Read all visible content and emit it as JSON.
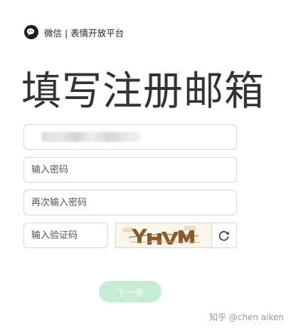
{
  "brand": {
    "text": "微信 | 表情开放平台",
    "logo_icon": "wechat-logo-icon"
  },
  "title": "填写注册邮箱",
  "form": {
    "email": {
      "value": "",
      "note": "value is blurred/obscured in screenshot"
    },
    "password": {
      "placeholder": "输入密码"
    },
    "confirm_password": {
      "placeholder": "再次输入密码"
    },
    "verification_code": {
      "placeholder": "输入验证码"
    },
    "captcha": {
      "text": "YHVM",
      "refresh_icon": "refresh-icon"
    },
    "next_button": {
      "label": "下一步"
    }
  },
  "watermark": "知乎 @chen aiken",
  "colors": {
    "button_bg": "#c6ecd4",
    "captcha_ink": "#8a5a2b",
    "border": "#d6d6d6"
  }
}
